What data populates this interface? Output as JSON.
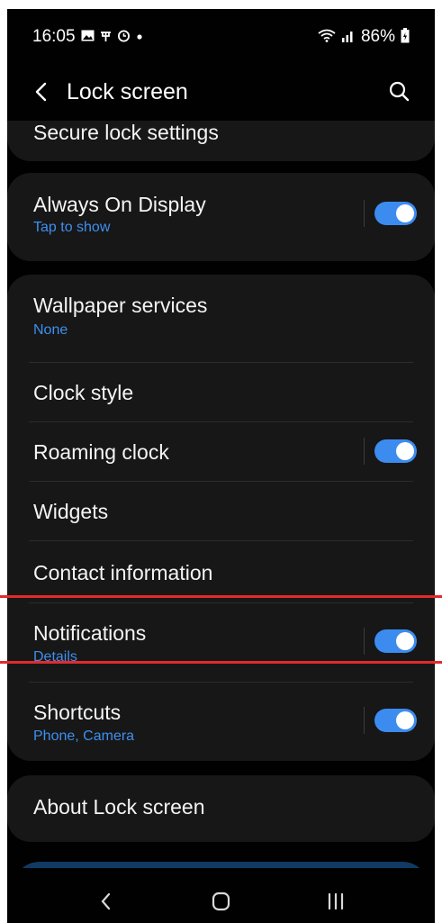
{
  "status_bar": {
    "time": "16:05",
    "battery": "86%"
  },
  "header": {
    "title": "Lock screen"
  },
  "items": {
    "secure_lock": {
      "title": "Secure lock settings"
    },
    "always_on": {
      "title": "Always On Display",
      "subtitle": "Tap to show",
      "toggle": true
    },
    "wallpaper": {
      "title": "Wallpaper services",
      "subtitle": "None"
    },
    "clock_style": {
      "title": "Clock style"
    },
    "roaming_clock": {
      "title": "Roaming clock",
      "toggle": true
    },
    "widgets": {
      "title": "Widgets"
    },
    "contact_info": {
      "title": "Contact information"
    },
    "notifications": {
      "title": "Notifications",
      "subtitle": "Details",
      "toggle": true
    },
    "shortcuts": {
      "title": "Shortcuts",
      "subtitle": "Phone, Camera",
      "toggle": true
    },
    "about": {
      "title": "About Lock screen"
    }
  },
  "colors": {
    "accent": "#3c8cf0",
    "subtitle": "#3e8ff0",
    "background": "#010101",
    "card": "#171717",
    "highlight_line": "#e32b2b"
  }
}
